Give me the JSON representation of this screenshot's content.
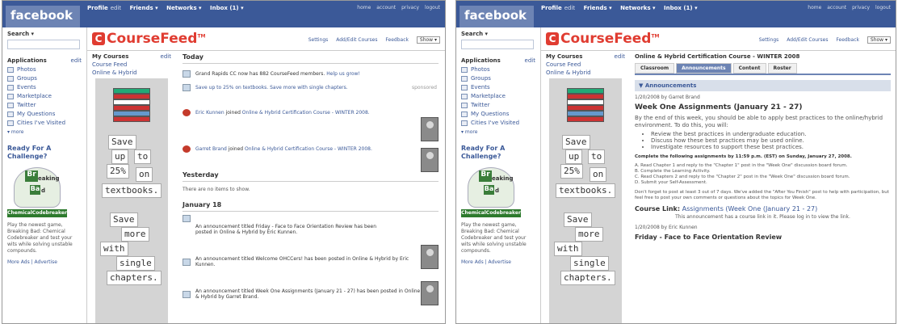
{
  "topbar": {
    "logo": "facebook",
    "nav": [
      "Profile",
      "edit",
      "Friends ▾",
      "Networks ▾",
      "Inbox (1) ▾"
    ],
    "links": [
      "home",
      "account",
      "privacy",
      "logout"
    ]
  },
  "sidebar": {
    "search_label": "Search ▾",
    "apps_label": "Applications",
    "apps_edit": "edit",
    "apps": [
      "Photos",
      "Groups",
      "Events",
      "Marketplace",
      "Twitter",
      "My Questions",
      "Cities I've Visited"
    ],
    "more": "▾ more",
    "ad_title": "Ready For A Challenge?",
    "ad_el1": "Br",
    "ad_el1_rest": "eaking",
    "ad_el2": "Ba",
    "ad_el2_rest": "d",
    "ad_banner": "ChemicalCodebreaker",
    "ad_text": "Play the newest game, Breaking Bad: Chemical Codebreaker and test your wits while solving unstable compounds.",
    "ad_links": "More Ads | Advertise"
  },
  "coursefeed": {
    "logo": "CourseFeed",
    "tm": "TM",
    "links": [
      "Settings",
      "Add/Edit Courses",
      "Feedback"
    ],
    "select": "Show ▾"
  },
  "mycourses": {
    "label": "My Courses",
    "edit": "edit",
    "items": [
      "Course Feed",
      "Online & Hybrid"
    ]
  },
  "ad_words": [
    "Save",
    "up",
    "to",
    "25%",
    "on",
    "textbooks.",
    "Save",
    "more",
    "with",
    "single",
    "chapters."
  ],
  "feed": {
    "today": "Today",
    "items": [
      {
        "pre": "",
        "text": "Grand Rapids CC now has 882 CourseFeed members.",
        "link": "Help us grow!"
      },
      {
        "pre": "",
        "text": "",
        "link": "Save up to 25% on textbooks. Save more with single chapters."
      },
      {
        "pre": "Eric Kunnen",
        "text": " joined ",
        "link": "Online & Hybrid Certification Course - WINTER 2008."
      },
      {
        "pre": "Garret Brand",
        "text": " joined ",
        "link": "Online & Hybrid Certification Course - WINTER 2008."
      }
    ],
    "sponsored": "sponsored",
    "yesterday": "Yesterday",
    "no_items": "There are no items to show.",
    "jan18": "January 18",
    "jan_items": [
      "An announcement titled Friday - Face to Face Orientation Review has been posted in Online & Hybrid by Eric Kunnen.",
      "An announcement titled Welcome OHCCers! has been posted in Online & Hybrid by Eric Kunnen.",
      "An announcement titled Week One Assignments (January 21 - 27) has been posted in Online & Hybrid by Garret Brand."
    ]
  },
  "course": {
    "title": "Online & Hybrid Certification Course - WINTER 2008",
    "tabs": [
      "Classroom",
      "Announcements",
      "Content",
      "Roster"
    ],
    "ann_bar": "▼ Announcements",
    "meta1": "1/20/2008 by Garret Brand",
    "heading": "Week One Assignments (January 21 - 27)",
    "para": "By the end of this week, you should be able to apply best practices to the online/hybrid environment. To do this, you will:",
    "bullets": [
      "Review the best practices in undergraduate education.",
      "Discuss how these best practices may be used online.",
      "Investigate resources to support these best practices."
    ],
    "complete": "Complete the following assignments by 11:59 p.m. (EST) on Sunday, January 27, 2008.",
    "steps": [
      "A. Read Chapter 1 and reply to the \"Chapter 1\" post in the \"Week One\" discussion board forum.",
      "B. Complete the Learning Activity.",
      "C. Read Chapters 2 and reply to the \"Chapter 2\" post in the \"Week One\" discussion board forum.",
      "D. Submit your Self-Assessment."
    ],
    "reminder": "Don't forget to post at least 3 out of 7 days. We've added the \"After You Finish\" post to help with participation, but feel free to post your own comments or questions about the topics for Week One.",
    "course_link_label": "Course Link:",
    "course_link": "Assignments (Week One (January 21 - 27)",
    "link_note": "This announcement has a course link in it. Please log in to view the link.",
    "meta2": "1/20/2008 by Eric Kunnen",
    "next": "Friday - Face to Face Orientation Review"
  }
}
